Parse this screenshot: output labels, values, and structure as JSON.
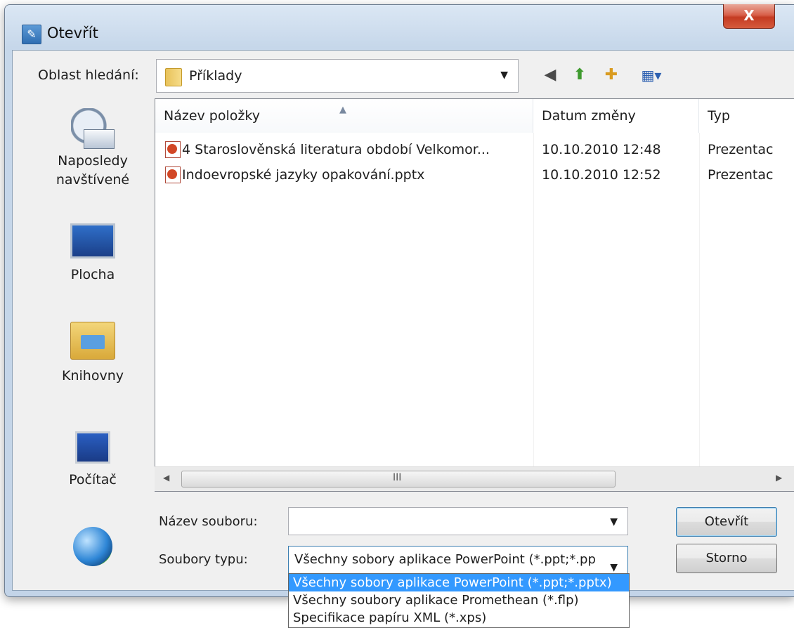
{
  "window": {
    "title": "Otevřít",
    "title_icon": "open-file-dialog-icon",
    "close_label": "X"
  },
  "toolbar": {
    "lookin_label": "Oblast hledání:",
    "lookin_value": "Příklady",
    "icons": [
      "back-icon",
      "up-folder-icon",
      "new-folder-icon",
      "views-menu-icon"
    ]
  },
  "places": [
    {
      "label_line1": "Naposledy",
      "label_line2": "navštívené",
      "icon": "recent-places-icon"
    },
    {
      "label_line1": "Plocha",
      "label_line2": "",
      "icon": "desktop-icon"
    },
    {
      "label_line1": "Knihovny",
      "label_line2": "",
      "icon": "libraries-icon"
    },
    {
      "label_line1": "Počítač",
      "label_line2": "",
      "icon": "computer-icon"
    },
    {
      "label_line1": "",
      "label_line2": "",
      "icon": "network-icon"
    }
  ],
  "filelist": {
    "columns": {
      "name": "Název položky",
      "date": "Datum změny",
      "type": "Typ"
    },
    "rows": [
      {
        "name": "4 Staroslověnská literatura období Velkomor...",
        "date": "10.10.2010 12:48",
        "type": "Prezentac",
        "icon": "powerpoint-file-icon"
      },
      {
        "name": "Indoevropské jazyky opakování.pptx",
        "date": "10.10.2010 12:52",
        "type": "Prezentac",
        "icon": "powerpoint-file-icon"
      }
    ],
    "scroll_grip": "III"
  },
  "filename": {
    "label": "Název souboru:",
    "value": ""
  },
  "filetype": {
    "label": "Soubory typu:",
    "selected": "Všechny sobory aplikace PowerPoint (*.ppt;*.pp",
    "options": [
      "Všechny sobory aplikace PowerPoint (*.ppt;*.pptx)",
      "Všechny soubory aplikace Promethean (*.flp)",
      "Specifikace papíru XML (*.xps)"
    ]
  },
  "buttons": {
    "open": "Otevřít",
    "cancel": "Storno"
  }
}
